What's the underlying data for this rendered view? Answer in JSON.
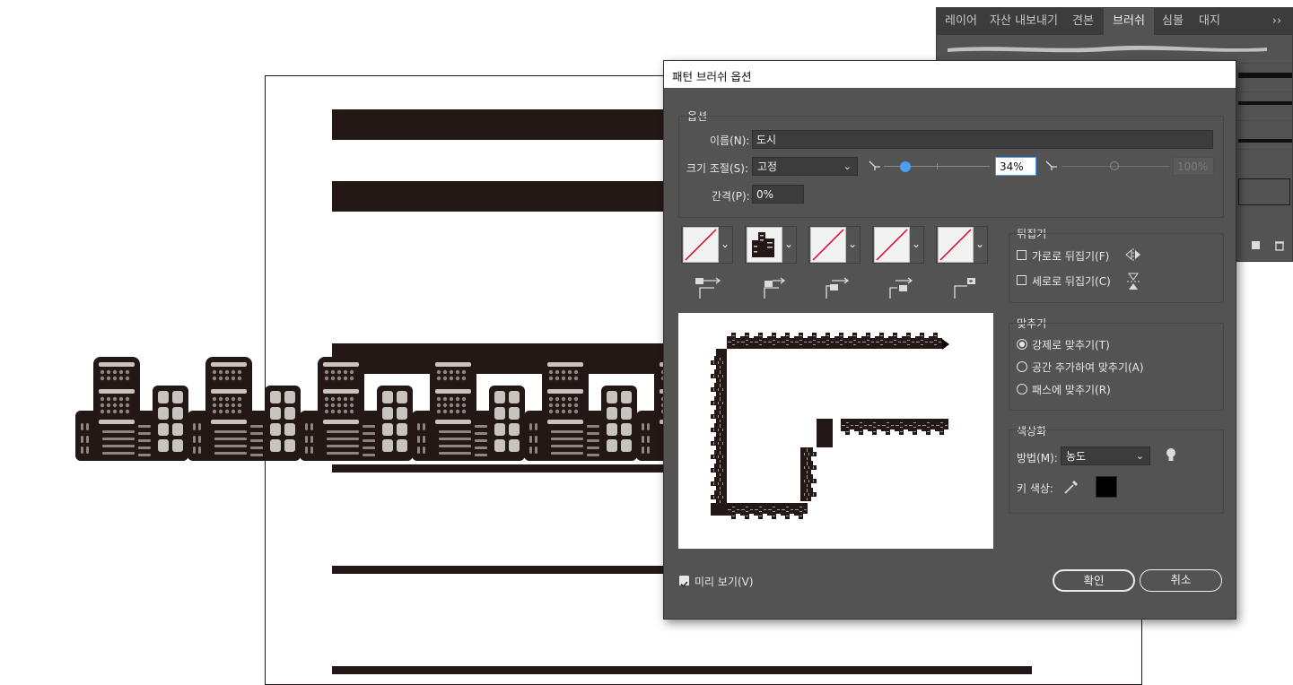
{
  "panel": {
    "tabs": [
      "레이어",
      "자산 내보내기",
      "견본",
      "브러쉬",
      "심볼",
      "대지"
    ],
    "active_tab": "브러쉬",
    "overflow_label": "››"
  },
  "dialog": {
    "title": "패턴 브러쉬 옵션",
    "options_group": "옵션",
    "name_label": "이름(N):",
    "name_value": "도시",
    "scale_label": "크기 조절(S):",
    "scale_value": "고정",
    "scale_min_value": "34%",
    "scale_max_value": "100%",
    "spacing_label": "간격(P):",
    "spacing_value": "0%",
    "flip_group": "뒤집기",
    "flip_h_label": "가로로 뒤집기(F)",
    "flip_v_label": "세로로 뒤집기(C)",
    "flip_h_checked": false,
    "flip_v_checked": false,
    "fit_group": "맞추기",
    "fit_options": [
      "강제로 맞추기(T)",
      "공간 추가하여 맞추기(A)",
      "패스에 맞추기(R)"
    ],
    "fit_selected": 0,
    "color_group": "색상화",
    "method_label": "방법(M):",
    "method_value": "농도",
    "key_color_label": "키 색상:",
    "key_color": "#000000",
    "preview_label": "미리 보기(V)",
    "preview_checked": true,
    "ok_label": "확인",
    "cancel_label": "취소"
  },
  "colors": {
    "dialog_bg": "#535353",
    "accent": "#4a9ff5",
    "ink": "#231815",
    "building_light": "#c9c3bf",
    "building_mid": "#8e8480"
  }
}
